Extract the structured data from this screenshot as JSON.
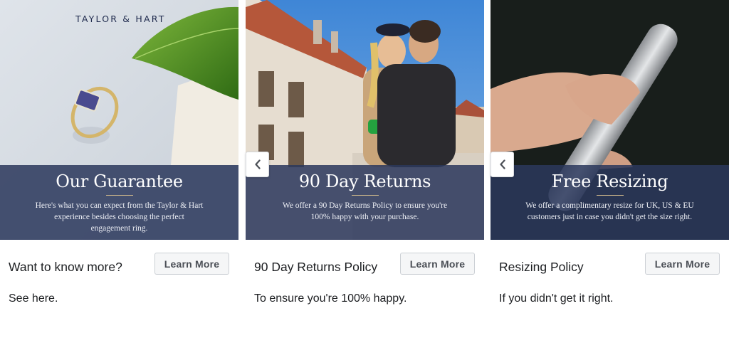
{
  "cards": [
    {
      "brand": "TAYLOR & HART",
      "overlay_title": "Our Guarantee",
      "overlay_text": "Here's what you can expect from the Taylor & Hart experience besides choosing the perfect engagement ring.",
      "headline": "Want to know more?",
      "description": "See here.",
      "button_label": "Learn More"
    },
    {
      "overlay_title": "90 Day Returns",
      "overlay_text": "We offer a 90 Day Returns Policy to ensure you're 100% happy with your purchase.",
      "headline": "90 Day Returns Policy",
      "description": "To ensure you're 100% happy.",
      "button_label": "Learn More"
    },
    {
      "overlay_title": "Free Resizing",
      "overlay_text": "We offer a complimentary resize for UK, US & EU customers just in case you didn't get the size right.",
      "headline": "Resizing Policy",
      "description": "If you didn't get it right.",
      "button_label": "Learn More"
    }
  ],
  "nav": {
    "prev_icon": "chevron-left-icon"
  },
  "colors": {
    "overlay": "#2b385c",
    "button_bg": "#f5f6f7",
    "button_text": "#4b4f56",
    "gold_rule": "#c9b48a"
  }
}
